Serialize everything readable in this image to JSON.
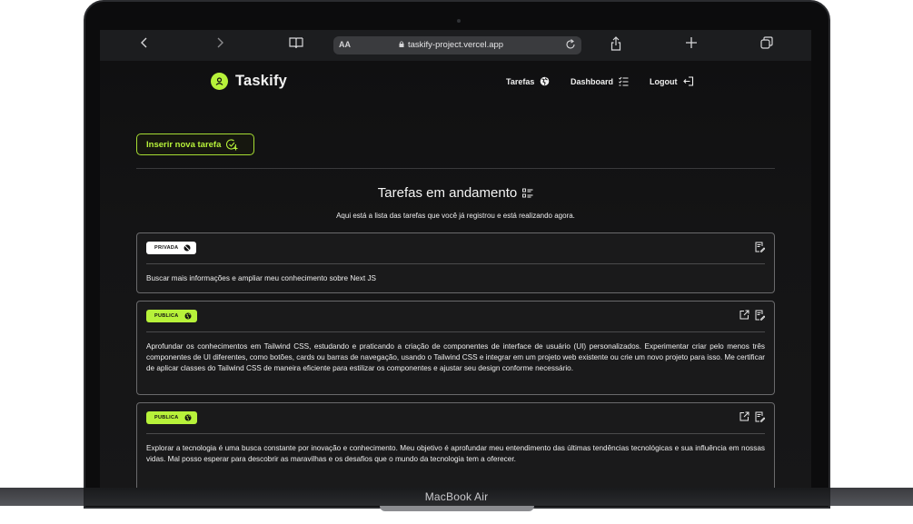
{
  "device": {
    "label": "MacBook Air"
  },
  "browser": {
    "text_size_label": "AA",
    "url": "taskify-project.vercel.app",
    "icons": [
      "back-icon",
      "forward-icon",
      "bookmarks-icon",
      "lock-icon",
      "reload-icon",
      "share-icon",
      "new-tab-icon",
      "tabs-icon"
    ]
  },
  "app": {
    "brand": "Taskify",
    "accent_color": "#b7f23a",
    "nav": [
      {
        "label": "Tarefas",
        "icon": "globe-icon"
      },
      {
        "label": "Dashboard",
        "icon": "checklist-icon"
      },
      {
        "label": "Logout",
        "icon": "logout-icon"
      }
    ],
    "insert_button_label": "Inserir nova tarefa",
    "section_title": "Tarefas em andamento",
    "section_subtitle": "Aqui está a lista das tarefas que você já registrou e está realizando agora.",
    "tasks": [
      {
        "visibility": "PRIVADA",
        "description": "Buscar mais informações e ampliar meu conhecimento sobre Next JS"
      },
      {
        "visibility": "PUBLICA",
        "description": "Aprofundar os conhecimentos em Tailwind CSS, estudando e praticando a criação de componentes de interface de usuário (UI) personalizados. Experimentar criar pelo menos três componentes de UI diferentes, como botões, cards ou barras de navegação, usando o Tailwind CSS e integrar em um projeto web existente ou crie um novo projeto para isso. Me certificar de aplicar classes do Tailwind CSS de maneira eficiente para estilizar os componentes e ajustar seu design conforme necessário."
      },
      {
        "visibility": "PUBLICA",
        "description": "Explorar a tecnologia é uma busca constante por inovação e conhecimento. Meu objetivo é aprofundar meu entendimento das últimas tendências tecnológicas e sua influência em nossas vidas. Mal posso esperar para descobrir as maravilhas e os desafios que o mundo da tecnologia tem a oferecer."
      }
    ]
  }
}
